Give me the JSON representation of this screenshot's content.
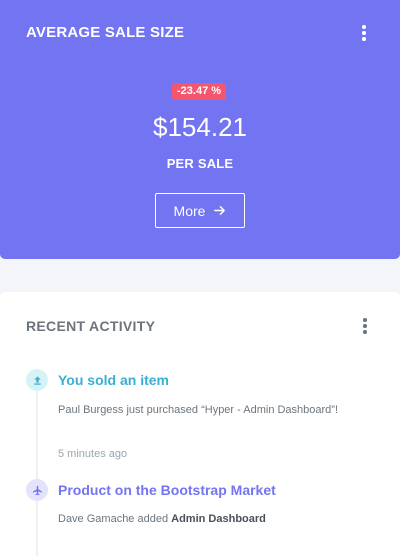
{
  "sale_card": {
    "title": "AVERAGE SALE SIZE",
    "change_badge": "-23.47 %",
    "amount": "$154.21",
    "unit": "PER SALE",
    "more_label": "More",
    "colors": {
      "background": "#7274f2",
      "badge": "#f4566e"
    }
  },
  "activity_card": {
    "title": "RECENT ACTIVITY",
    "items": [
      {
        "icon": "upload-icon",
        "heading": "You sold an item",
        "text": "Paul Burgess just purchased “Hyper - Admin Dashboard”!",
        "time": "5 minutes ago",
        "color": "#39afd1"
      },
      {
        "icon": "airplane-icon",
        "heading": "Product on the Bootstrap Market",
        "text_prefix": "Dave Gamache added ",
        "text_bold": "Admin Dashboard",
        "color": "#7274f2"
      }
    ]
  }
}
